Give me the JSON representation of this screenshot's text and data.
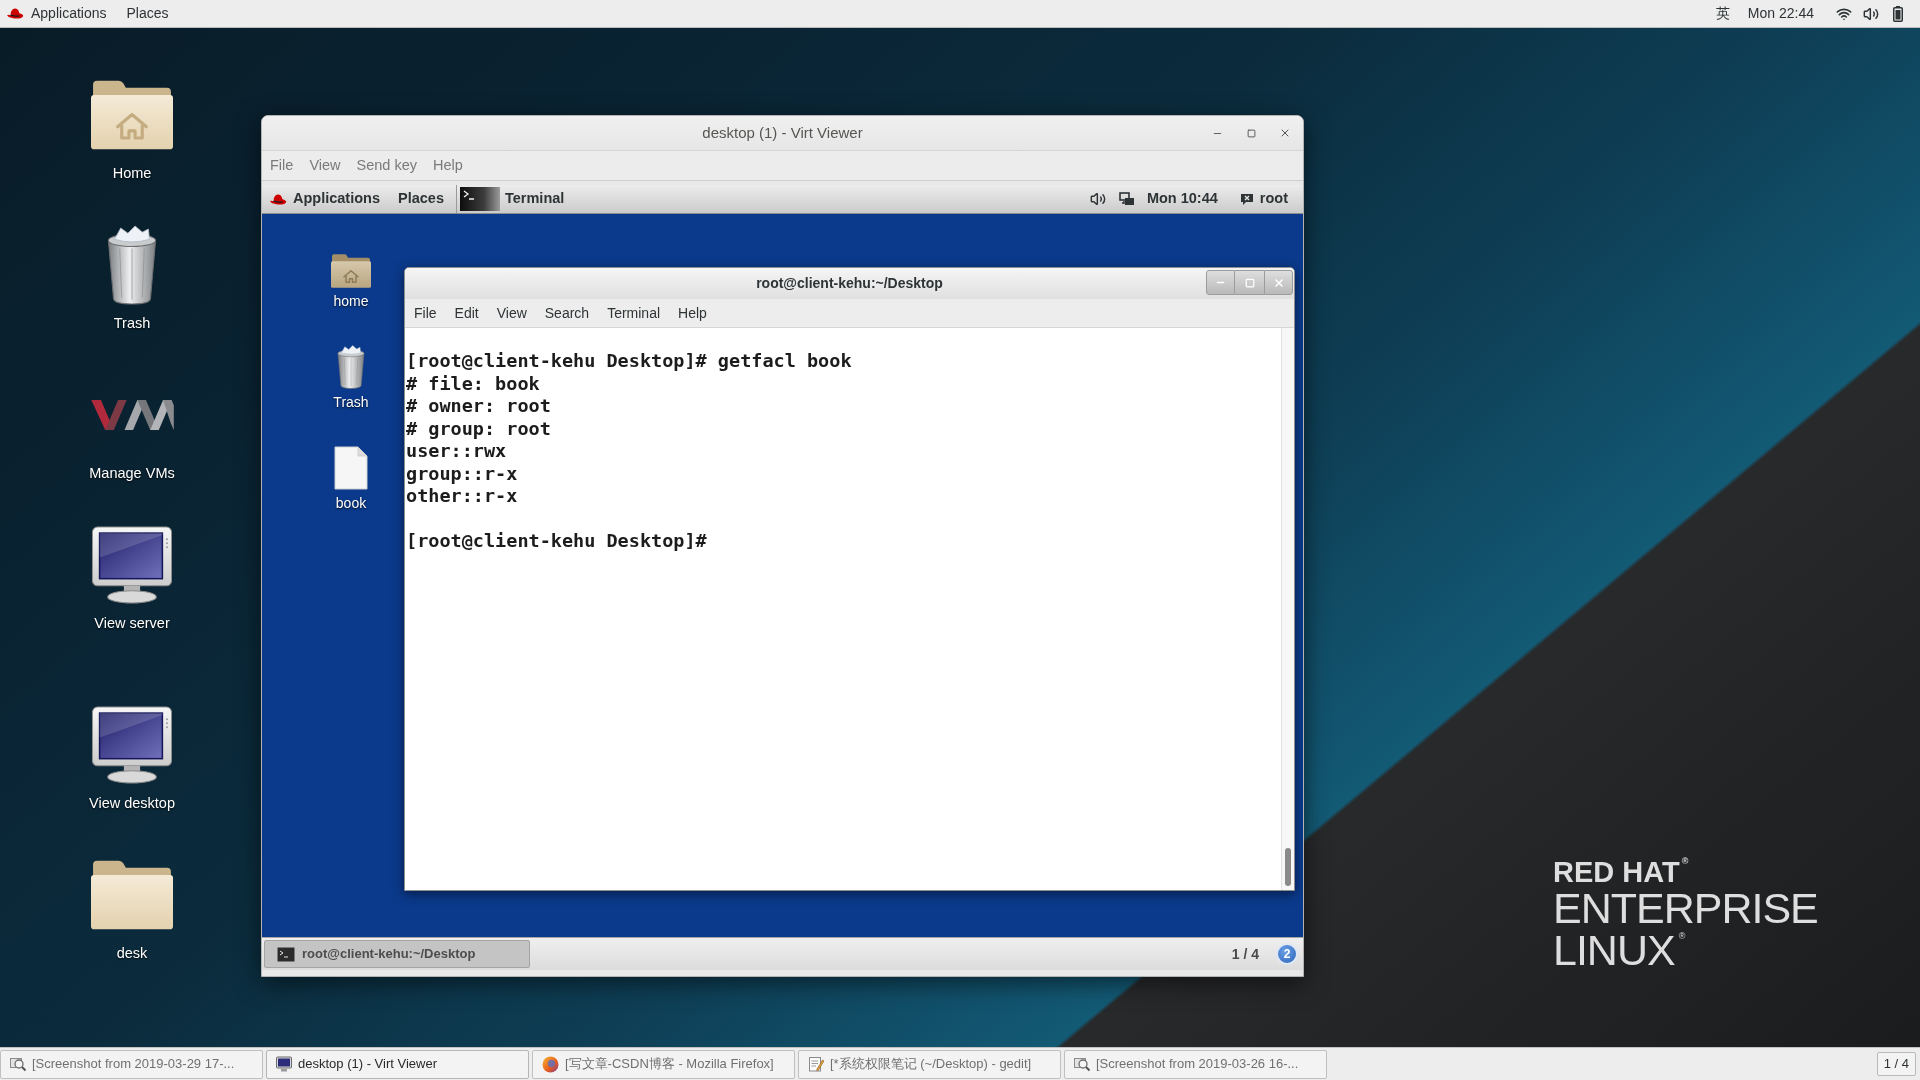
{
  "top_bar": {
    "applications_menu": "Applications",
    "places_menu": "Places",
    "input_method": "英",
    "clock": "Mon 22:44"
  },
  "desktop_icons": [
    {
      "label": "Home",
      "kind": "home_folder"
    },
    {
      "label": "Trash",
      "kind": "trash"
    },
    {
      "label": "Manage VMs",
      "kind": "vm_manager"
    },
    {
      "label": "View server",
      "kind": "monitor"
    },
    {
      "label": "View desktop",
      "kind": "monitor"
    },
    {
      "label": "desk",
      "kind": "folder"
    }
  ],
  "virt_viewer": {
    "title": "desktop (1) - Virt Viewer",
    "menus": [
      "File",
      "View",
      "Send key",
      "Help"
    ],
    "guest": {
      "top_panel": {
        "applications_menu": "Applications",
        "places_menu": "Places",
        "active_app": "Terminal",
        "clock": "Mon 10:44",
        "user": "root"
      },
      "desktop_icons": [
        {
          "label": "home",
          "kind": "home_folder"
        },
        {
          "label": "Trash",
          "kind": "trash"
        },
        {
          "label": "book",
          "kind": "file"
        }
      ],
      "terminal": {
        "title": "root@client-kehu:~/Desktop",
        "menus": [
          "File",
          "Edit",
          "View",
          "Search",
          "Terminal",
          "Help"
        ],
        "blocks": [
          {
            "lines": [
              "[root@client-kehu Desktop]# getfacl book",
              "# file: book",
              "# owner: root",
              "# group: root",
              "user::rwx",
              "group::r-x",
              "other::r-x"
            ]
          },
          {
            "lines": [
              "[root@client-kehu Desktop]#"
            ]
          }
        ]
      },
      "bottom_panel": {
        "tasks": [
          {
            "label": "root@client-kehu:~/Desktop",
            "selected": true
          }
        ],
        "workspace": "1 / 4",
        "notification_count": "2"
      }
    }
  },
  "taskbar": {
    "tasks": [
      {
        "label": "[Screenshot from 2019-03-29 17-...",
        "kind": "screenshot",
        "minimized": true
      },
      {
        "label": "desktop (1) - Virt Viewer",
        "kind": "viewer",
        "minimized": false
      },
      {
        "label": "[写文章-CSDN博客 - Mozilla Firefox]",
        "kind": "browser",
        "minimized": true
      },
      {
        "label": "[*系统权限笔记 (~/Desktop) - gedit]",
        "kind": "editor",
        "minimized": true
      },
      {
        "label": "[Screenshot from 2019-03-26 16-...",
        "kind": "screenshot",
        "minimized": true
      }
    ],
    "workspace": "1 / 4"
  },
  "branding": {
    "company": "RED HAT$^{®}$",
    "product_lines": [
      "ENTERPRISE",
      "LINUX$^{®}$"
    ]
  }
}
